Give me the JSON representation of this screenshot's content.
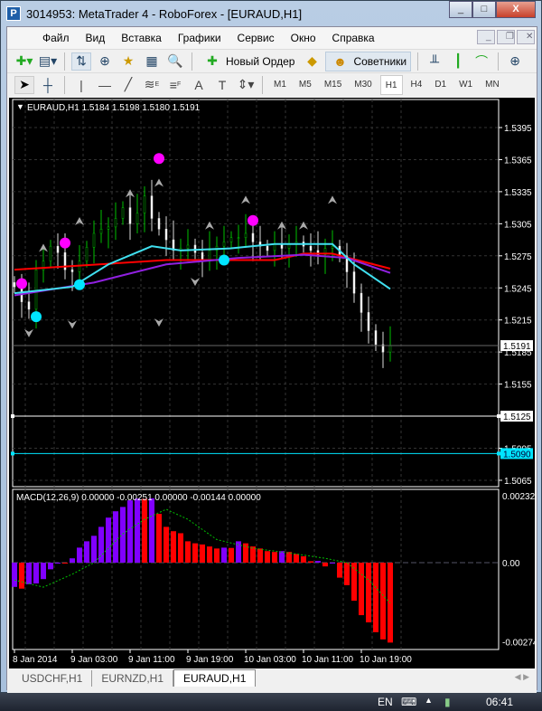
{
  "window": {
    "title": "3014953: MetaTrader 4 - RoboForex - [EURAUD,H1]",
    "minimize": "_",
    "maximize": "□",
    "close": "X"
  },
  "menu": [
    "Файл",
    "Вид",
    "Вставка",
    "Графики",
    "Сервис",
    "Окно",
    "Справка"
  ],
  "toolbar": {
    "new_order": "Новый Ордер",
    "experts": "Советники"
  },
  "drawing_tools": {
    "text": "A",
    "fibo_e": "E",
    "fibo_f": "F"
  },
  "timeframes": [
    "M1",
    "M5",
    "M15",
    "M30",
    "H1",
    "H4",
    "D1",
    "W1",
    "MN"
  ],
  "selected_timeframe": "H1",
  "chart": {
    "header": "EURAUD,H1  1.5184 1.5198 1.5180 1.5191",
    "price_ticks": [
      "1.5395",
      "1.5365",
      "1.5335",
      "1.5305",
      "1.5275",
      "1.5245",
      "1.5215",
      "1.5185",
      "1.5155",
      "1.5125",
      "1.5095",
      "1.5065"
    ],
    "price_range": [
      1.5065,
      1.5395
    ],
    "current_price": "1.5191",
    "hlines": [
      {
        "label": "1.5125",
        "value": 1.5125,
        "color": "#ffffff"
      },
      {
        "label": "1.5090",
        "value": 1.509,
        "color": "#00e5ff"
      }
    ],
    "closes": [
      1.5246,
      1.5232,
      1.5225,
      1.5262,
      1.527,
      1.5284,
      1.5278,
      1.5262,
      1.526,
      1.527,
      1.5283,
      1.5296,
      1.53,
      1.5302,
      1.531,
      1.532,
      1.5305,
      1.5315,
      1.5331,
      1.531,
      1.53,
      1.529,
      1.528,
      1.5282,
      1.5285,
      1.5278,
      1.527,
      1.528,
      1.5284,
      1.5288,
      1.5292,
      1.5292,
      1.5296,
      1.5288,
      1.5284,
      1.528,
      1.5286,
      1.5282,
      1.5286,
      1.5288,
      1.5284,
      1.528,
      1.5276,
      1.5282,
      1.5284,
      1.5275,
      1.526,
      1.524,
      1.5222,
      1.5205,
      1.5192,
      1.5185,
      1.5191
    ],
    "ma_red": [
      [
        0,
        1.5262
      ],
      [
        21,
        1.5271
      ],
      [
        36,
        1.5271
      ],
      [
        40,
        1.5277
      ],
      [
        44,
        1.5277
      ],
      [
        52,
        1.5263
      ]
    ],
    "ma_purple": [
      [
        0,
        1.5238
      ],
      [
        11,
        1.525
      ],
      [
        21,
        1.5267
      ],
      [
        31,
        1.5273
      ],
      [
        40,
        1.5276
      ],
      [
        46,
        1.5273
      ],
      [
        52,
        1.5259
      ]
    ],
    "ma_cyan": [
      [
        0,
        1.524
      ],
      [
        8,
        1.5246
      ],
      [
        13,
        1.5267
      ],
      [
        19,
        1.5284
      ],
      [
        23,
        1.528
      ],
      [
        30,
        1.5282
      ],
      [
        36,
        1.5286
      ],
      [
        44,
        1.5286
      ],
      [
        47,
        1.5267
      ],
      [
        52,
        1.5244
      ]
    ],
    "dots_magenta": [
      [
        1,
        1.5249
      ],
      [
        7,
        1.5287
      ],
      [
        20,
        1.5366
      ],
      [
        33,
        1.5308
      ]
    ],
    "dots_cyan": [
      [
        3,
        1.5218
      ],
      [
        9,
        1.5248
      ],
      [
        29,
        1.5271
      ]
    ],
    "arrows_up": [
      [
        4,
        1.5282
      ],
      [
        9,
        1.5307
      ],
      [
        16,
        1.5333
      ],
      [
        20,
        1.5343
      ],
      [
        27,
        1.5303
      ],
      [
        32,
        1.5327
      ],
      [
        37,
        1.5303
      ],
      [
        40,
        1.5303
      ],
      [
        44,
        1.5327
      ]
    ],
    "arrows_down": [
      [
        2,
        1.5203
      ],
      [
        8,
        1.5211
      ],
      [
        20,
        1.5213
      ],
      [
        25,
        1.5251
      ]
    ]
  },
  "macd": {
    "label": "MACD(12,26,9) 0.00000 -0.00251 0.00000 -0.00144 0.00000",
    "ticks": [
      "0.00232",
      "0.00",
      "-0.00274"
    ],
    "range": [
      -0.00274,
      0.00232
    ],
    "histogram": [
      -0.00084,
      -0.0009,
      -0.00075,
      -0.00072,
      -0.00057,
      -0.00023,
      0,
      0,
      0.00015,
      0.00052,
      0.00074,
      0.00093,
      0.00124,
      0.00156,
      0.00178,
      0.00193,
      0.00216,
      0.00222,
      0.00221,
      0.00223,
      0.00169,
      0.00124,
      0.00109,
      0.00102,
      0.00074,
      0.00067,
      0.00063,
      0.00056,
      0.00049,
      0.00052,
      0.00051,
      0.00074,
      0.00067,
      0.00056,
      0.00049,
      0.0004,
      0.00037,
      0.0004,
      0.00037,
      0.0003,
      0.00022,
      5e-05,
      6e-05,
      -0.00013,
      0,
      -0.00052,
      -0.00078,
      -0.00132,
      -0.00182,
      -0.00207,
      -0.00241,
      -0.00266,
      -0.00277
    ],
    "signal": [
      [
        0,
        -0.0006
      ],
      [
        4,
        -0.00085
      ],
      [
        8,
        -0.0004
      ],
      [
        11,
        0
      ],
      [
        15,
        0.001
      ],
      [
        18,
        0.0015
      ],
      [
        21,
        0.00185
      ],
      [
        24,
        0.0015
      ],
      [
        28,
        0.0008
      ],
      [
        33,
        0.0005
      ],
      [
        39,
        0.0003
      ],
      [
        43,
        0.00015
      ],
      [
        46,
        0
      ],
      [
        49,
        -0.0006
      ],
      [
        52,
        -0.0014
      ]
    ],
    "up_color": "#8000ff",
    "down_color": "#ff0000",
    "signal_color": "#00c000"
  },
  "time_labels": [
    "8 Jan 2014",
    "9 Jan 03:00",
    "9 Jan 11:00",
    "9 Jan 19:00",
    "10 Jan 03:00",
    "10 Jan 11:00",
    "10 Jan 19:00"
  ],
  "tabs": [
    "USDCHF,H1",
    "EURNZD,H1",
    "EURAUD,H1"
  ],
  "active_tab": "EURAUD,H1",
  "taskbar": {
    "lang": "EN",
    "clock": "06:41"
  }
}
